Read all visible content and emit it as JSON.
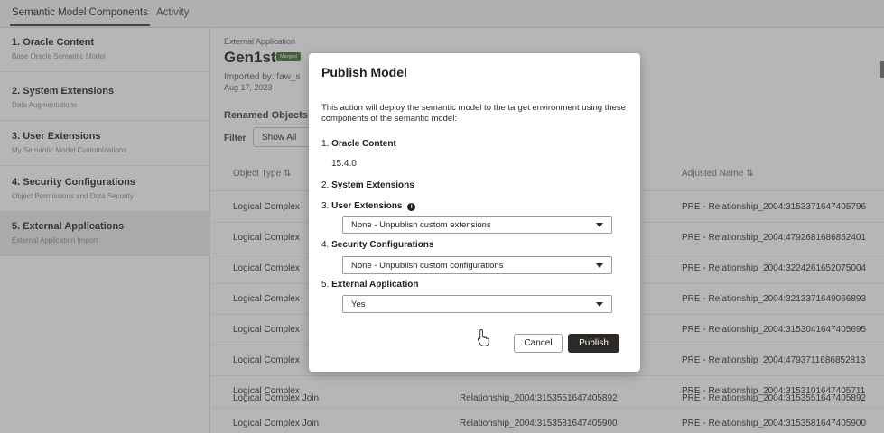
{
  "tabs": [
    {
      "label": "Semantic Model Components"
    },
    {
      "label": "Activity"
    }
  ],
  "sidebar": {
    "items": [
      {
        "label": "1. Oracle Content",
        "sub": "Base Oracle Semantic Model"
      },
      {
        "label": "2. System Extensions",
        "sub": "Data Augmentations"
      },
      {
        "label": "3. User Extensions",
        "sub": "My Semantic Model Customizations"
      },
      {
        "label": "4. Security Configurations",
        "sub": "Object Permissions and Data Security"
      },
      {
        "label": "5. External Applications",
        "sub": "External Application Import"
      }
    ]
  },
  "main": {
    "kind": "External Application",
    "title": "Gen1st",
    "badge": "Merged",
    "imported_by": "Imported by: faw_s",
    "date": "Aug 17, 2023",
    "renamed_heading": "Renamed Objects",
    "filter_label": "Filter",
    "filter_value": "Show All",
    "columns": {
      "object_type": "Object Type ⇅",
      "adjusted_name": "Adjusted Name ⇅"
    },
    "rows": [
      {
        "type": "Logical Complex",
        "original": "",
        "adjusted": "PRE - Relationship_2004:3153371647405796"
      },
      {
        "type": "Logical Complex",
        "original": "",
        "adjusted": "PRE - Relationship_2004:4792681686852401"
      },
      {
        "type": "Logical Complex",
        "original": "",
        "adjusted": "PRE - Relationship_2004:3224261652075004"
      },
      {
        "type": "Logical Complex",
        "original": "",
        "adjusted": "PRE - Relationship_2004:3213371649066893"
      },
      {
        "type": "Logical Complex",
        "original": "",
        "adjusted": "PRE - Relationship_2004:3153041647405695"
      },
      {
        "type": "Logical Complex",
        "original": "",
        "adjusted": "PRE - Relationship_2004:4793711686852813"
      },
      {
        "type": "Logical Complex",
        "original": "",
        "adjusted": "PRE - Relationship_2004:3153101647405711"
      },
      {
        "type": "Logical Complex Join",
        "original": "Relationship_2004:3153551647405892",
        "adjusted": "PRE - Relationship_2004:3153551647405892"
      },
      {
        "type": "Logical Complex Join",
        "original": "Relationship_2004:3153581647405900",
        "adjusted": "PRE - Relationship_2004:3153581647405900"
      }
    ]
  },
  "dialog": {
    "title": "Publish Model",
    "description": "This action will deploy the semantic model to the target environment using these components of the semantic model:",
    "sections": {
      "oracle_content_num": "1.",
      "oracle_content": "Oracle Content",
      "oracle_version": "15.4.0",
      "system_ext_num": "2.",
      "system_ext": "System Extensions",
      "user_ext_num": "3.",
      "user_ext": "User Extensions",
      "security_num": "4.",
      "security": "Security Configurations",
      "external_num": "5.",
      "external": "External Application"
    },
    "selects": {
      "user_ext": "None - Unpublish custom extensions",
      "security": "None - Unpublish custom configurations",
      "external": "Yes"
    },
    "cancel_label": "Cancel",
    "publish_label": "Publish"
  },
  "icons": {
    "info": "info-icon",
    "cursor": "hand-pointer-icon",
    "caret": "chevron-down-icon"
  }
}
